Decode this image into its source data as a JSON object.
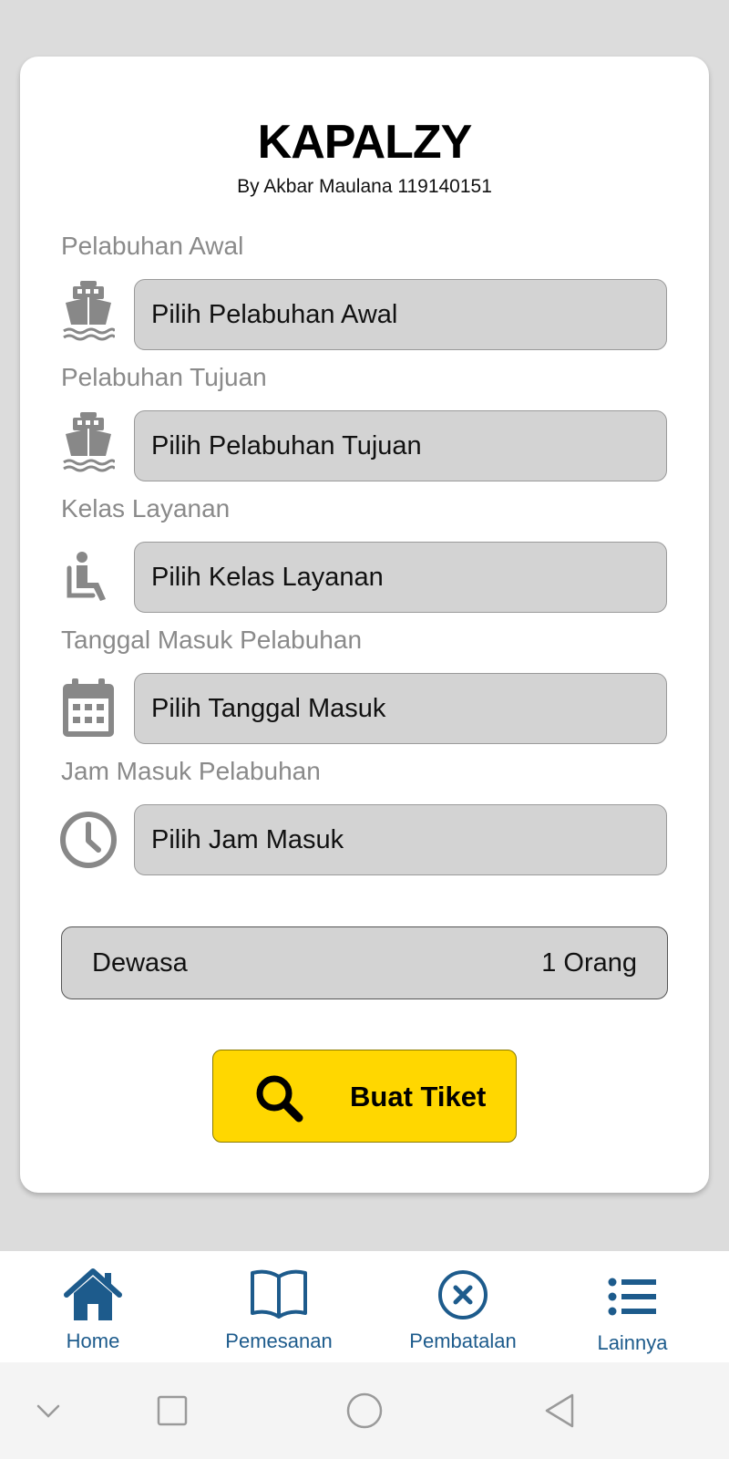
{
  "header": {
    "title": "KAPALZY",
    "subtitle": "By Akbar Maulana 119140151"
  },
  "form": {
    "fields": [
      {
        "label": "Pelabuhan Awal",
        "placeholder": "Pilih Pelabuhan Awal",
        "icon": "ship-icon"
      },
      {
        "label": "Pelabuhan Tujuan",
        "placeholder": "Pilih Pelabuhan Tujuan",
        "icon": "ship-icon"
      },
      {
        "label": "Kelas Layanan",
        "placeholder": "Pilih Kelas Layanan",
        "icon": "seat-icon"
      },
      {
        "label": "Tanggal Masuk Pelabuhan",
        "placeholder": "Pilih Tanggal Masuk",
        "icon": "calendar-icon"
      },
      {
        "label": "Jam Masuk Pelabuhan",
        "placeholder": "Pilih Jam Masuk",
        "icon": "clock-icon"
      }
    ],
    "passenger": {
      "type": "Dewasa",
      "count": "1 Orang"
    },
    "submit_label": "Buat Tiket",
    "submit_icon": "search-icon"
  },
  "bottom_nav": {
    "items": [
      {
        "label": "Home",
        "icon": "home-icon"
      },
      {
        "label": "Pemesanan",
        "icon": "book-icon"
      },
      {
        "label": "Pembatalan",
        "icon": "cancel-circle-icon"
      },
      {
        "label": "Lainnya",
        "icon": "list-icon"
      }
    ]
  },
  "system_nav": {
    "icons": [
      "chevron-down-icon",
      "recent-apps-icon",
      "home-circle-icon",
      "back-icon"
    ]
  },
  "colors": {
    "accent_yellow": "#ffd700",
    "nav_blue": "#1d5b8c",
    "field_gray": "#d3d3d3",
    "icon_gray": "#888888"
  }
}
